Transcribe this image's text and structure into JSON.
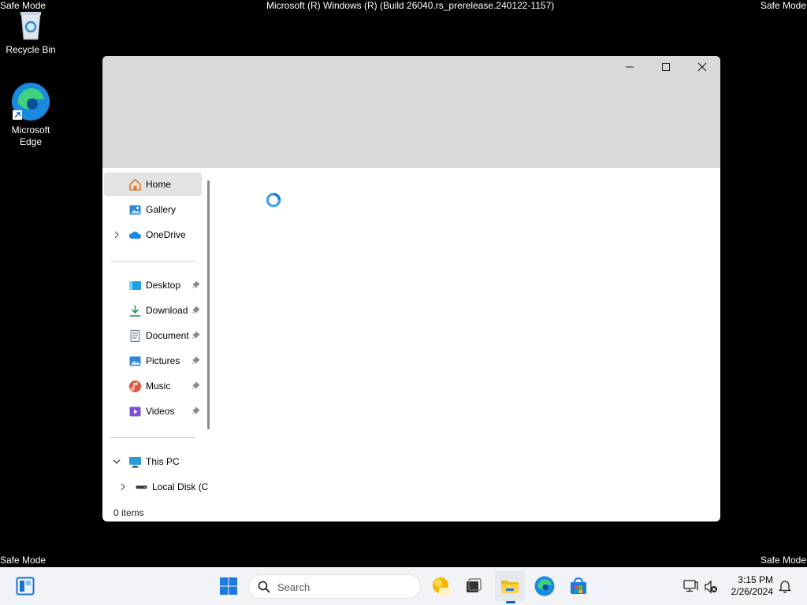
{
  "banners": {
    "safe_mode_label": "Safe Mode",
    "build": "Microsoft (R) Windows (R) (Build 26040.rs_prerelease.240122-1157)"
  },
  "desktop": {
    "icons": [
      {
        "label": "Recycle Bin",
        "icon": "recycle-bin-icon"
      },
      {
        "label": "Microsoft Edge",
        "icon": "edge-icon"
      }
    ]
  },
  "explorer": {
    "nav": {
      "items": [
        {
          "label": "Home",
          "icon": "home-icon",
          "selected": true
        },
        {
          "label": "Gallery",
          "icon": "gallery-icon"
        },
        {
          "label": "OneDrive",
          "icon": "onedrive-icon",
          "expandable": true
        },
        {
          "label": "Desktop",
          "icon": "desktop-folder-icon",
          "pinned": true
        },
        {
          "label": "Download",
          "icon": "download-icon",
          "pinned": true
        },
        {
          "label": "Document",
          "icon": "documents-icon",
          "pinned": true
        },
        {
          "label": "Pictures",
          "icon": "pictures-icon",
          "pinned": true
        },
        {
          "label": "Music",
          "icon": "music-icon",
          "pinned": true
        },
        {
          "label": "Videos",
          "icon": "videos-icon",
          "pinned": true
        },
        {
          "label": "This PC",
          "icon": "this-pc-icon",
          "expanded": true
        },
        {
          "label": "Local Disk (C",
          "icon": "drive-icon",
          "expandable": true
        }
      ]
    },
    "status": "0 items",
    "loading": true
  },
  "taskbar": {
    "search_placeholder": "Search",
    "pinned": [
      "widgets-icon",
      "start-icon",
      "search-icon",
      "copilot-pre-icon",
      "task-view-icon",
      "file-explorer-icon",
      "edge-icon",
      "store-icon"
    ],
    "active_app": "file-explorer-icon",
    "time": "3:15 PM",
    "date": "2/26/2024"
  },
  "colors": {
    "accent": "#0067c0",
    "titlebar": "#d9d9d9",
    "taskbar": "#f1f3f6"
  }
}
